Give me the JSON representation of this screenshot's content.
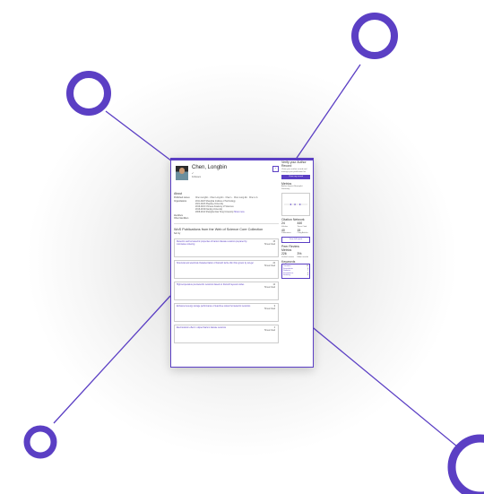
{
  "profile": {
    "name": "Chen, Longbin",
    "verified_icon": "verified-icon",
    "followers_label": "Followers"
  },
  "about": {
    "section_title": "About",
    "published_names_label": "Published names",
    "published_names": "Chen Longbin · Chen Long-bin · Chen L · Chen Lung-bin · Chen L.b.",
    "organizations_label": "Organizations",
    "orgs": [
      {
        "year": "2011-2023",
        "org": "Shanghai Institute of Technology"
      },
      {
        "year": "2021-2023",
        "org": "Zhejiang University"
      },
      {
        "year": "2019-2021",
        "org": "Chinese Academy of Sciences"
      },
      {
        "year": "2016-2019",
        "org": "Nanjing University"
      },
      {
        "year": "2008-2014",
        "org": "Shanghai Jiao Tong University"
      }
    ],
    "show_more": "Show more",
    "identifiers_label": "Identifiers",
    "other_identifiers_label": "Other Identifiers"
  },
  "publications": {
    "section_title": "WoS Publications from the Web of Science Core Collection",
    "sort_label": "Sort by",
    "items": [
      {
        "title": "Dielectric and ferroelectric properties of barium titanate ceramics prepared by microwave sintering",
        "cites": "15",
        "cites_label": "Times Cited"
      },
      {
        "title": "Structural and electrical characterization of bismuth ferrite thin films grown by sol-gel",
        "cites": "22",
        "cites_label": "Times Cited"
      },
      {
        "title": "High-temperature piezoelectric ceramics based on bismuth layered oxides",
        "cites": "12",
        "cites_label": "Times Cited"
      },
      {
        "title": "Enhanced energy storage performance of lead-free relaxor ferroelectric ceramics",
        "cites": "9",
        "cites_label": "Times Cited"
      },
      {
        "title": "Electrocaloric effect in doped barium titanate ceramics",
        "cites": "4",
        "cites_label": "Times Cited"
      }
    ]
  },
  "sidebar": {
    "verify_title": "Verify your Author Record",
    "verify_text": "Claim your author record and manage your publication list",
    "verify_button": "Claim my record",
    "metrics_title": "Metrics",
    "author_impact_title": "Author Impact Beamplot Summary",
    "citation_network_title": "Citation Network",
    "view_full_report": "View full report",
    "metrics": [
      {
        "value": "24",
        "label": "H-Index"
      },
      {
        "value": "440",
        "label": "Times Cited"
      },
      {
        "value": "40",
        "label": "Publications"
      },
      {
        "value": "15",
        "label": "Citing Articles"
      }
    ],
    "peer_review_title": "Peer Review Metrics",
    "peer_metrics": [
      {
        "value": "226",
        "label": "Verified reviews"
      },
      {
        "value": "3%",
        "label": "Editor records"
      }
    ],
    "keywords_title": "Keywords",
    "keywords": [
      {
        "word": "Ceramics",
        "count": "12"
      },
      {
        "word": "Ferroelectric",
        "count": "9"
      },
      {
        "word": "Dielectric",
        "count": "7"
      },
      {
        "word": "Piezoelectric",
        "count": "5"
      },
      {
        "word": "Sintering",
        "count": "4"
      }
    ]
  },
  "colors": {
    "accent": "#5b3fc4"
  },
  "decoration": {
    "circles": [
      "top-left ring",
      "top-right ring",
      "bottom-left ring",
      "bottom-right ring"
    ]
  }
}
